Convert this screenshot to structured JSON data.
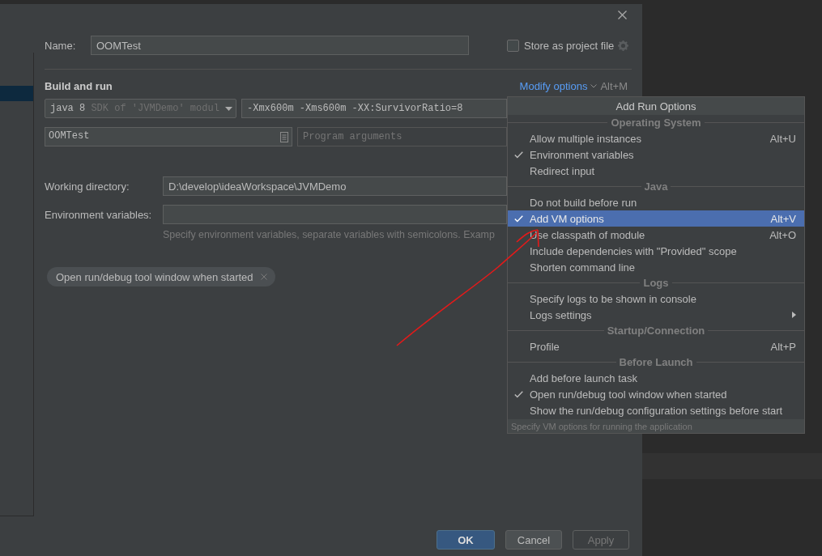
{
  "dialog": {
    "name_label": "Name:",
    "name_value": "OOMTest",
    "store_checkbox": {
      "label": "Store as project file",
      "checked": false
    },
    "section_title": "Build and run",
    "modify_options": {
      "label": "Modify options",
      "shortcut": "Alt+M"
    },
    "jre": {
      "value": "java 8",
      "hint": "SDK of 'JVMDemo' modul"
    },
    "vm_options": "-Xmx600m -Xms600m -XX:SurvivorRatio=8",
    "main_class": "OOMTest",
    "program_args": {
      "placeholder": "Program arguments"
    },
    "working_directory": {
      "label": "Working directory:",
      "value": "D:\\develop\\ideaWorkspace\\JVMDemo"
    },
    "environment_variables": {
      "label": "Environment variables:",
      "hint": "Specify environment variables, separate variables with semicolons. Examp"
    },
    "chips": [
      {
        "label": "Open run/debug tool window when started"
      }
    ],
    "buttons": [
      {
        "label": "OK",
        "kind": "primary",
        "disabled": false
      },
      {
        "label": "Cancel",
        "kind": "normal",
        "disabled": false
      },
      {
        "label": "Apply",
        "kind": "normal",
        "disabled": true
      }
    ]
  },
  "menu": {
    "title": "Add Run Options",
    "items": [
      {
        "kind": "section",
        "label": "Operating System"
      },
      {
        "kind": "item",
        "label": "Allow multiple instances",
        "shortcut": "Alt+U",
        "checked": false,
        "selected": false,
        "submenu": false
      },
      {
        "kind": "item",
        "label": "Environment variables",
        "checked": true,
        "selected": false,
        "submenu": false
      },
      {
        "kind": "item",
        "label": "Redirect input",
        "checked": false,
        "selected": false,
        "submenu": false
      },
      {
        "kind": "section",
        "label": "Java"
      },
      {
        "kind": "item",
        "label": "Do not build before run",
        "checked": false,
        "selected": false,
        "submenu": false
      },
      {
        "kind": "item",
        "label": "Add VM options",
        "shortcut": "Alt+V",
        "checked": true,
        "selected": true,
        "submenu": false
      },
      {
        "kind": "item",
        "label": "Use classpath of module",
        "shortcut": "Alt+O",
        "checked": false,
        "selected": false,
        "submenu": false
      },
      {
        "kind": "item",
        "label": "Include dependencies with \"Provided\" scope",
        "checked": false,
        "selected": false,
        "submenu": false
      },
      {
        "kind": "item",
        "label": "Shorten command line",
        "checked": false,
        "selected": false,
        "submenu": false
      },
      {
        "kind": "section",
        "label": "Logs"
      },
      {
        "kind": "item",
        "label": "Specify logs to be shown in console",
        "checked": false,
        "selected": false,
        "submenu": false
      },
      {
        "kind": "item",
        "label": "Logs settings",
        "checked": false,
        "selected": false,
        "submenu": true
      },
      {
        "kind": "section",
        "label": "Startup/Connection"
      },
      {
        "kind": "item",
        "label": "Profile",
        "shortcut": "Alt+P",
        "checked": false,
        "selected": false,
        "submenu": false
      },
      {
        "kind": "section",
        "label": "Before Launch"
      },
      {
        "kind": "item",
        "label": "Add before launch task",
        "checked": false,
        "selected": false,
        "submenu": false
      },
      {
        "kind": "item",
        "label": "Open run/debug tool window when started",
        "checked": true,
        "selected": false,
        "submenu": false
      },
      {
        "kind": "item",
        "label": "Show the run/debug configuration settings before start",
        "checked": false,
        "selected": false,
        "submenu": false
      }
    ],
    "footer": "Specify VM options for running the application"
  }
}
